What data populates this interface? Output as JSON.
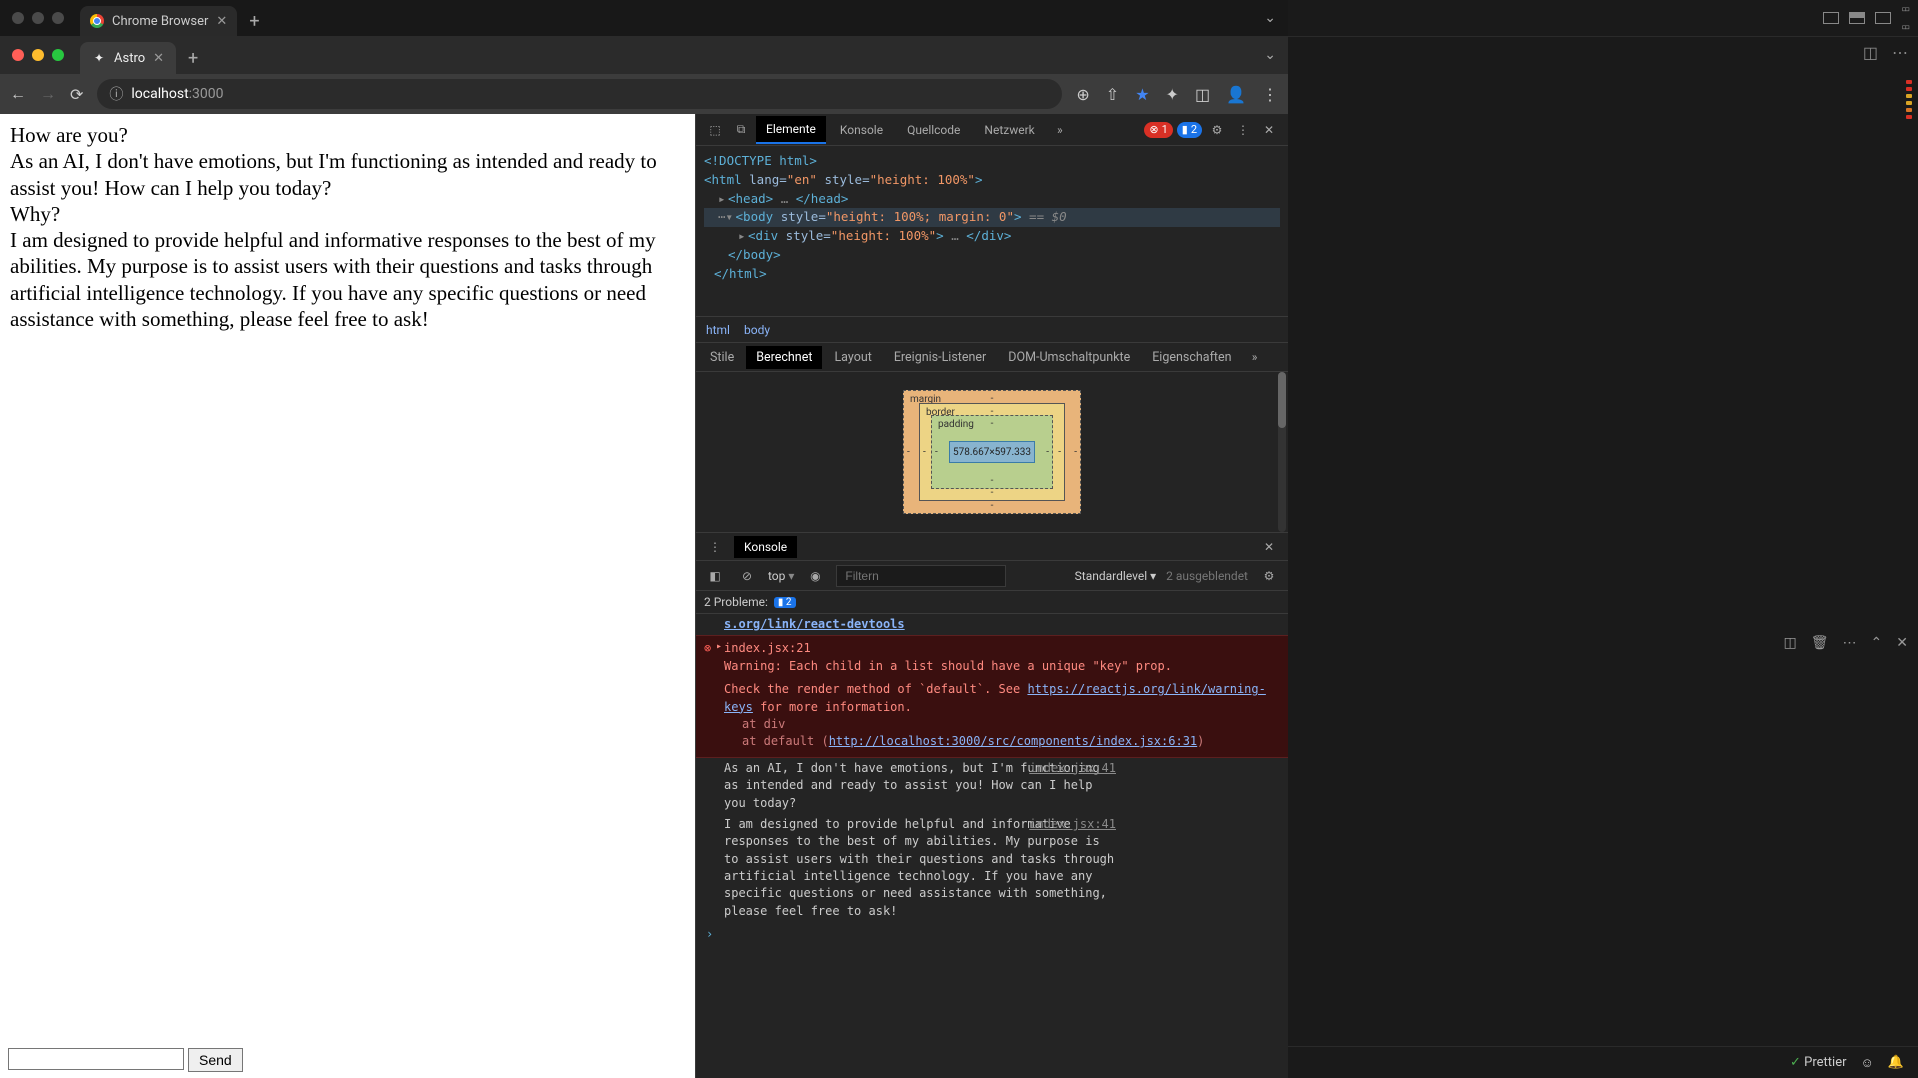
{
  "outer": {
    "tab_title": "Chrome Browser",
    "chevron": "⌄"
  },
  "inner": {
    "tab_title": "Astro",
    "url_host": "localhost",
    "url_path": ":3000"
  },
  "chat": {
    "messages": [
      "How are you?",
      "As an AI, I don't have emotions, but I'm functioning as intended and ready to assist you! How can I help you today?",
      "Why?",
      "I am designed to provide helpful and informative responses to the best of my abilities. My purpose is to assist users with their questions and tasks through artificial intelligence technology. If you have any specific questions or need assistance with something, please feel free to ask!"
    ],
    "send_label": "Send"
  },
  "devtools": {
    "tabs": {
      "elements": "Elemente",
      "console": "Konsole",
      "sources": "Quellcode",
      "network": "Netzwerk"
    },
    "err_count": "1",
    "msg_count": "2",
    "dom": {
      "doctype": "<!DOCTYPE html>",
      "html_open": "<html lang=\"en\" style=\"height: 100%\">",
      "head": "<head> … </head>",
      "body_open": "<body style=\"height: 100%; margin: 0\">",
      "eq0": " == $0",
      "div": "<div style=\"height: 100%\"> … </div>",
      "body_close": "</body>",
      "html_close": "</html>"
    },
    "crumbs": {
      "a": "html",
      "b": "body"
    },
    "style_tabs": {
      "styles": "Stile",
      "computed": "Berechnet",
      "layout": "Layout",
      "listeners": "Ereignis-Listener",
      "dom_bp": "DOM-Umschaltpunkte",
      "props": "Eigenschaften"
    },
    "boxmodel": {
      "margin": "margin",
      "border": "border",
      "padding": "padding",
      "content": "578.667×597.333",
      "dash": "-"
    },
    "drawer": {
      "title": "Konsole",
      "top_label": "top",
      "filter_ph": "Filtern",
      "level": "Standardlevel",
      "hidden": "2 ausgeblendet",
      "problems_label": "2 Probleme:",
      "problems_count": "2",
      "truncated_link": "s.org/link/react-devtools",
      "err": {
        "head": "Warning: Each child in a list should have a unique \"key\" prop.",
        "src": "index.jsx:21",
        "line1a": "Check the render method of `default`. See ",
        "line1_link": "https://reactjs.org/link/warning-keys",
        "line1b": " for more information.",
        "stack1": "at div",
        "stack2a": "at default (",
        "stack2_link": "http://localhost:3000/src/components/index.jsx:6:31",
        "stack2b": ")"
      },
      "log1": {
        "text": "As an AI, I don't have emotions, but I'm functioning as intended and ready to assist you! How can I help you today?",
        "src": "index.jsx:41"
      },
      "log2": {
        "text": "I am designed to provide helpful and informative responses to the best of my abilities. My purpose is to assist users with their questions and tasks through artificial intelligence technology. If you have any specific questions or need assistance with something, please feel free to ask!",
        "src": "index.jsx:41"
      }
    }
  },
  "editor": {
    "prettier": "Prettier"
  }
}
